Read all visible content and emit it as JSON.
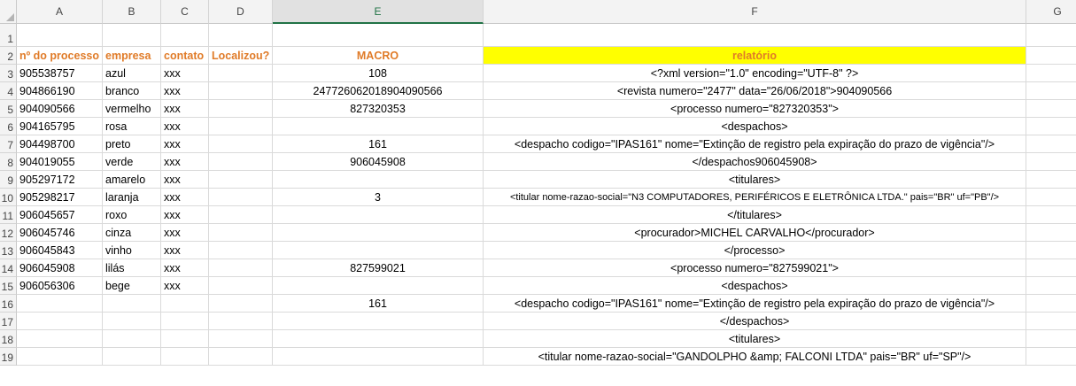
{
  "columns": [
    "A",
    "B",
    "C",
    "D",
    "E",
    "F",
    "G"
  ],
  "rows": [
    "1",
    "2",
    "3",
    "4",
    "5",
    "6",
    "7",
    "8",
    "9",
    "10",
    "11",
    "12",
    "13",
    "14",
    "15",
    "16",
    "17",
    "18",
    "19"
  ],
  "headers": {
    "processo": "nº do processo",
    "empresa": "empresa",
    "contato": "contato",
    "localizou": "Localizou?",
    "macro": "MACRO",
    "relatorio": "relatório"
  },
  "data_rows": [
    {
      "processo": "905538757",
      "empresa": "azul",
      "contato": "xxx",
      "localizou": "",
      "macro": "108",
      "relatorio": "<?xml version=\"1.0\" encoding=\"UTF-8\" ?>"
    },
    {
      "processo": "904866190",
      "empresa": "branco",
      "contato": "xxx",
      "localizou": "",
      "macro": "24772606201890409056​6",
      "relatorio": "<revista numero=\"2477\" data=\"26/06/2018\">904090566"
    },
    {
      "processo": "904090566",
      "empresa": "vermelho",
      "contato": "xxx",
      "localizou": "",
      "macro": "827320353",
      "relatorio": "<processo numero=\"827320353\">"
    },
    {
      "processo": "904165795",
      "empresa": "rosa",
      "contato": "xxx",
      "localizou": "",
      "macro": "",
      "relatorio": "<despachos>"
    },
    {
      "processo": "904498700",
      "empresa": "preto",
      "contato": "xxx",
      "localizou": "",
      "macro": "161",
      "relatorio": "<despacho codigo=\"IPAS161\" nome=\"Extinção de registro pela expiração do prazo de vigência\"/>"
    },
    {
      "processo": "904019055",
      "empresa": "verde",
      "contato": "xxx",
      "localizou": "",
      "macro": "906045908",
      "relatorio": "</despachos906045908>"
    },
    {
      "processo": "905297172",
      "empresa": "amarelo",
      "contato": "xxx",
      "localizou": "",
      "macro": "",
      "relatorio": "<titulares>"
    },
    {
      "processo": "905298217",
      "empresa": "laranja",
      "contato": "xxx",
      "localizou": "",
      "macro": "3",
      "relatorio": "<titular nome-razao-social=\"N3 COMPUTADORES, PERIFÉRICOS E ELETRÔNICA LTDA.\" pais=\"BR\" uf=\"PB\"/>",
      "small": true
    },
    {
      "processo": "906045657",
      "empresa": "roxo",
      "contato": "xxx",
      "localizou": "",
      "macro": "",
      "relatorio": "</titulares>"
    },
    {
      "processo": "906045746",
      "empresa": "cinza",
      "contato": "xxx",
      "localizou": "",
      "macro": "",
      "relatorio": "<procurador>MICHEL CARVALHO</procurador>"
    },
    {
      "processo": "906045843",
      "empresa": "vinho",
      "contato": "xxx",
      "localizou": "",
      "macro": "",
      "relatorio": "</processo>"
    },
    {
      "processo": "906045908",
      "empresa": "lilás",
      "contato": "xxx",
      "localizou": "",
      "macro": "827599021",
      "relatorio": "<processo numero=\"827599021\">"
    },
    {
      "processo": "906056306",
      "empresa": "bege",
      "contato": "xxx",
      "localizou": "",
      "macro": "",
      "relatorio": "<despachos>"
    },
    {
      "processo": "",
      "empresa": "",
      "contato": "",
      "localizou": "",
      "macro": "161",
      "relatorio": "<despacho codigo=\"IPAS161\" nome=\"Extinção de registro pela expiração do prazo de vigência\"/>"
    },
    {
      "processo": "",
      "empresa": "",
      "contato": "",
      "localizou": "",
      "macro": "",
      "relatorio": "</despachos>"
    },
    {
      "processo": "",
      "empresa": "",
      "contato": "",
      "localizou": "",
      "macro": "",
      "relatorio": "<titulares>"
    },
    {
      "processo": "",
      "empresa": "",
      "contato": "",
      "localizou": "",
      "macro": "",
      "relatorio": "<titular nome-razao-social=\"GANDOLPHO &amp; FALCONI LTDA\" pais=\"BR\" uf=\"SP\"/>"
    }
  ],
  "colors": {
    "header_text": "#e07b28",
    "highlight": "#ffff00",
    "selected_col": "#217346"
  }
}
